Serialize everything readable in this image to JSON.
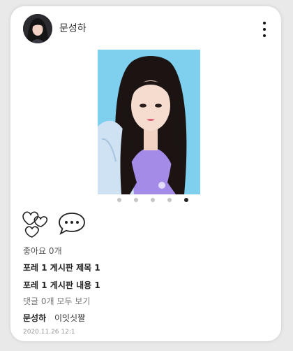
{
  "post": {
    "username": "문성하",
    "image_alt": "post photo",
    "carousel": {
      "total": 5,
      "current": 5
    },
    "likes_text": "좋아요 0개",
    "title": "포레 1 게시판 제목 1",
    "content": "포레 1 게시판 내용 1",
    "view_comments": "댓글 0개 모두 보기",
    "comment": {
      "username": "문성하",
      "text": "이잇싯짤"
    },
    "timestamp": "2020.11.26 12:1"
  },
  "icons": {
    "more": "more-vertical-icon",
    "like": "heart-outline-icon",
    "comment": "chat-bubble-icon"
  },
  "colors": {
    "background": "#e9e9e9",
    "card": "#ffffff",
    "dot_inactive": "#c4c4c4",
    "dot_active": "#222222"
  }
}
